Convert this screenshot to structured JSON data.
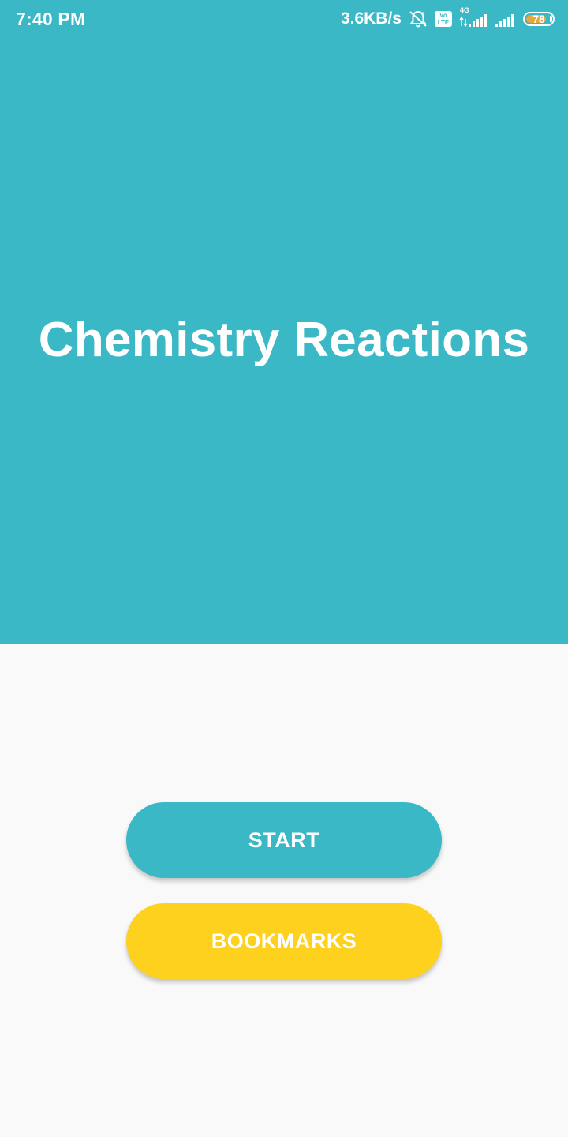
{
  "status_bar": {
    "time": "7:40 PM",
    "net_speed": "3.6KB/s",
    "volte_top": "Vo",
    "volte_bottom": "LTE",
    "network_type": "4G",
    "battery_level": "78",
    "battery_percent": 78,
    "icons": [
      "notifications-off-icon",
      "volte-icon",
      "signal-4g-icon",
      "signal-icon",
      "battery-icon"
    ]
  },
  "hero": {
    "title": "Chemistry Reactions"
  },
  "actions": {
    "start_label": "START",
    "bookmarks_label": "BOOKMARKS"
  },
  "colors": {
    "primary": "#3ab8c6",
    "accent": "#fdd11e",
    "background": "#f9f9f9",
    "battery": "#e9a93a"
  }
}
